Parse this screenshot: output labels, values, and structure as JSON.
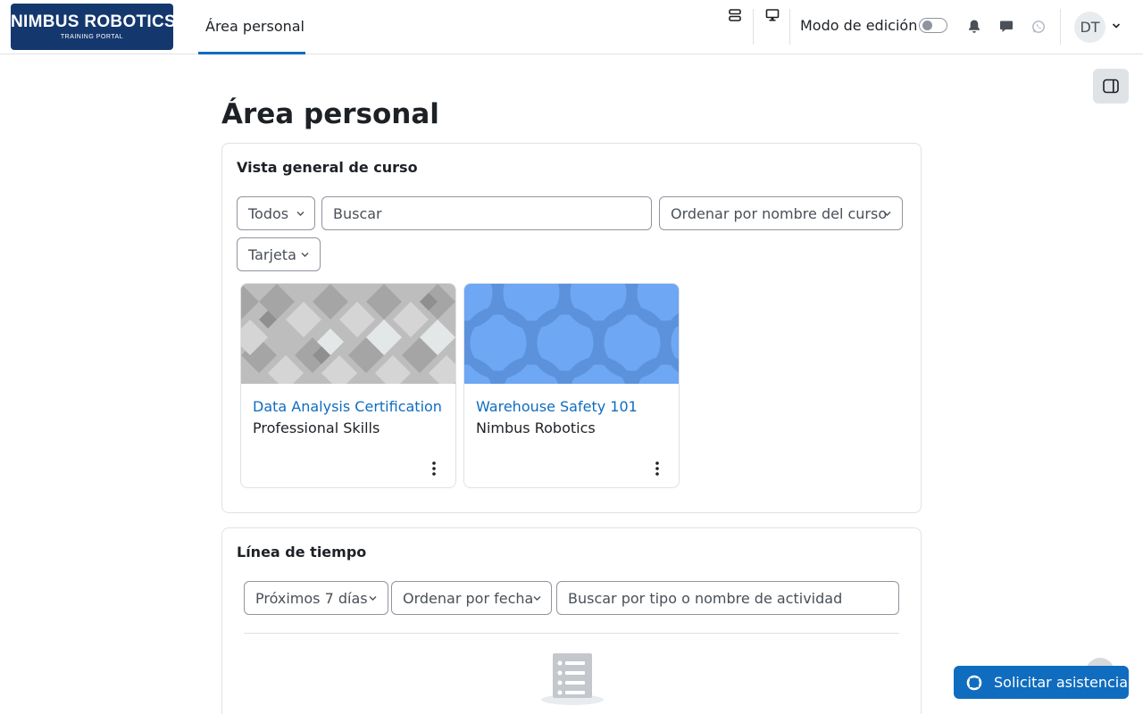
{
  "navbar": {
    "logo_line1": "NIMBUS ROBOTICS",
    "logo_line2": "TRAINING PORTAL",
    "active_tab": "Área personal",
    "edit_mode_label": "Modo de edición",
    "edit_mode_on": false,
    "user_initials": "DT",
    "icons": [
      "layout-stack-icon",
      "desktop-icon",
      "bell-icon",
      "chat-icon",
      "whatsapp-icon",
      "chevron-down-icon"
    ]
  },
  "page": {
    "title": "Área personal"
  },
  "course_overview": {
    "title": "Vista general de curso",
    "filter_label": "Todos",
    "search_placeholder": "Buscar",
    "sort_label": "Ordenar por nombre del curso",
    "view_label": "Tarjeta",
    "courses": [
      {
        "name": "Data Analysis Certification",
        "category": "Professional Skills",
        "pattern": "grey-diamonds"
      },
      {
        "name": "Warehouse Safety 101",
        "category": "Nimbus Robotics",
        "pattern": "blue-circles"
      }
    ]
  },
  "timeline": {
    "title": "Línea de tiempo",
    "range_label": "Próximos 7 días",
    "sort_label": "Ordenar por fecha",
    "search_placeholder": "Buscar por tipo o nombre de actividad"
  },
  "help": {
    "label": "Solicitar asistencia"
  },
  "colors": {
    "brand_navy": "#14386e",
    "link_blue": "#0f6cbf",
    "border": "#dee2e6"
  }
}
